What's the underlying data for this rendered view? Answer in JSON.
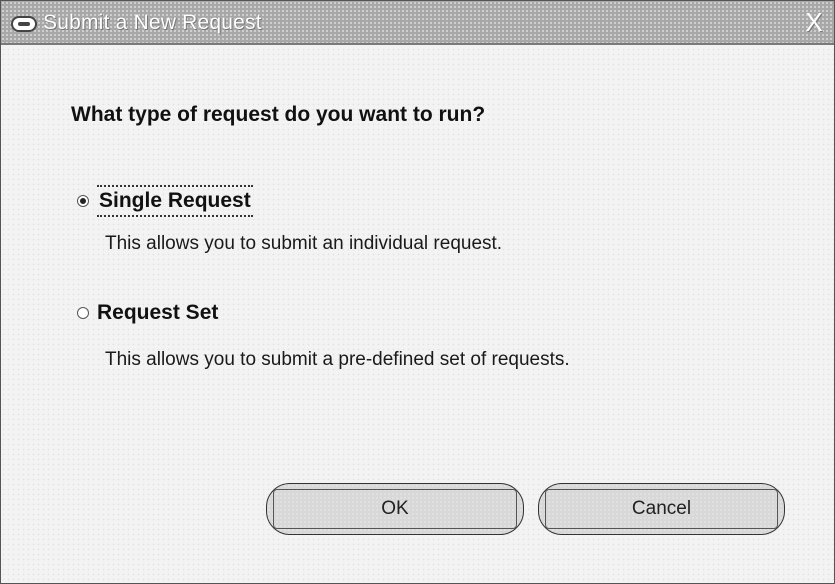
{
  "window": {
    "title": "Submit a New Request",
    "close_label": "X"
  },
  "question": "What type of request do you want to run?",
  "options": [
    {
      "label": "Single Request",
      "description": "This allows you to submit an individual request.",
      "selected": true
    },
    {
      "label": "Request Set",
      "description": "This allows you to submit a pre-defined set of requests.",
      "selected": false
    }
  ],
  "buttons": {
    "ok_label": "OK",
    "cancel_label": "Cancel"
  }
}
